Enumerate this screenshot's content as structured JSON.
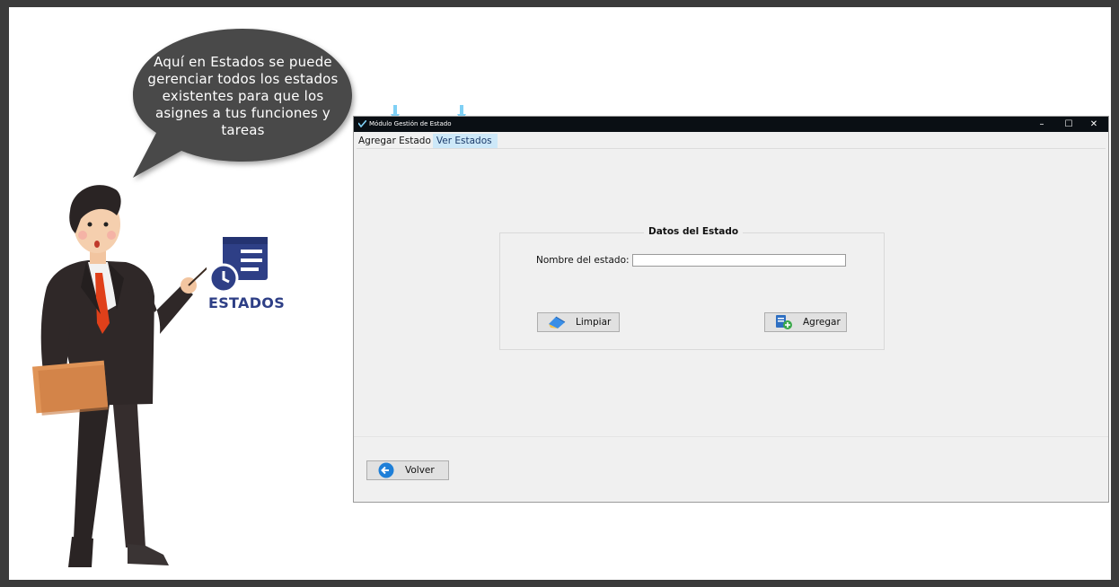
{
  "bubble": {
    "text": "Aquí en Estados se puede gerenciar todos los estados existentes para que los asignes a tus funciones y tareas"
  },
  "badge": {
    "label": "ESTADOS",
    "icon": "estados-icon"
  },
  "window": {
    "title": "Módulo Gestión de Estado",
    "controls": {
      "minimize": "–",
      "maximize": "☐",
      "close": "✕"
    }
  },
  "tabs": [
    {
      "label": "Agregar Estado",
      "active": true
    },
    {
      "label": "Ver Estados",
      "active": false
    }
  ],
  "form": {
    "group_title": "Datos del Estado",
    "name_label": "Nombre del estado:",
    "name_value": "",
    "clear_button": "Limpiar",
    "add_button": "Agregar"
  },
  "footer": {
    "back_button": "Volver"
  },
  "colors": {
    "accent": "#2e3f86",
    "titlebar": "#0a0f14",
    "tab_highlight": "#cde8f8",
    "arrow": "#7fd0f5"
  }
}
